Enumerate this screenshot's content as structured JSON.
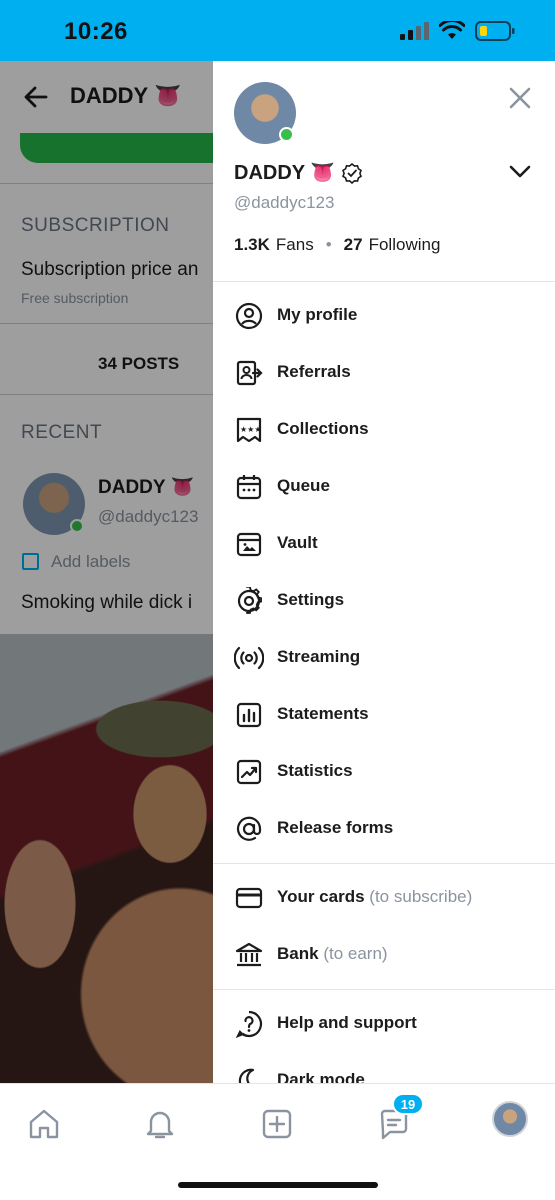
{
  "status": {
    "time": "10:26"
  },
  "background": {
    "title": "DADDY 👅",
    "subscription_heading": "SUBSCRIPTION",
    "subscription_text": "Subscription price an",
    "subscription_note": "Free subscription",
    "posts_tab": "34 POSTS",
    "recent_heading": "RECENT",
    "post": {
      "name": "DADDY 👅",
      "handle": "@daddyc123",
      "labels": "Add labels",
      "caption": "Smoking while dick i"
    }
  },
  "drawer": {
    "name": "DADDY 👅",
    "handle": "@daddyc123",
    "fans_count": "1.3K",
    "fans_label": "Fans",
    "following_count": "27",
    "following_label": "Following",
    "menu": [
      {
        "label": "My profile",
        "icon": "user-circle-icon"
      },
      {
        "label": "Referrals",
        "icon": "referral-icon"
      },
      {
        "label": "Collections",
        "icon": "collections-icon"
      },
      {
        "label": "Queue",
        "icon": "calendar-icon"
      },
      {
        "label": "Vault",
        "icon": "vault-icon"
      },
      {
        "label": "Settings",
        "icon": "gear-icon"
      },
      {
        "label": "Streaming",
        "icon": "broadcast-icon"
      },
      {
        "label": "Statements",
        "icon": "bar-chart-icon"
      },
      {
        "label": "Statistics",
        "icon": "trend-chart-icon"
      },
      {
        "label": "Release forms",
        "icon": "at-icon"
      }
    ],
    "payment": [
      {
        "label": "Your cards",
        "sub": "(to subscribe)",
        "icon": "card-icon"
      },
      {
        "label": "Bank",
        "sub": "(to earn)",
        "icon": "bank-icon"
      }
    ],
    "support": [
      {
        "label": "Help and support",
        "icon": "help-icon"
      },
      {
        "label": "Dark mode",
        "icon": "moon-icon"
      }
    ]
  },
  "bottom_nav": {
    "messages_badge": "19"
  },
  "colors": {
    "brand": "#00aff0",
    "online": "#35c04a",
    "muted": "#8a94a0"
  }
}
